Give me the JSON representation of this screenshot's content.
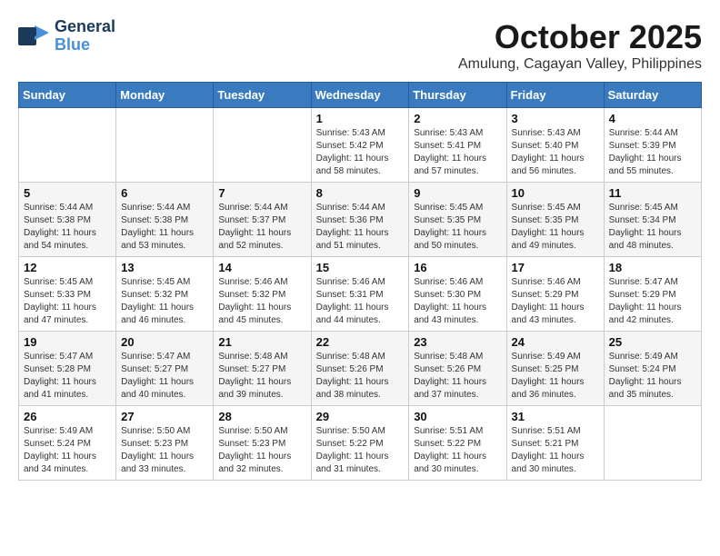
{
  "header": {
    "logo_general": "General",
    "logo_blue": "Blue",
    "month": "October 2025",
    "location": "Amulung, Cagayan Valley, Philippines"
  },
  "days_of_week": [
    "Sunday",
    "Monday",
    "Tuesday",
    "Wednesday",
    "Thursday",
    "Friday",
    "Saturday"
  ],
  "weeks": [
    [
      {
        "day": "",
        "info": ""
      },
      {
        "day": "",
        "info": ""
      },
      {
        "day": "",
        "info": ""
      },
      {
        "day": "1",
        "info": "Sunrise: 5:43 AM\nSunset: 5:42 PM\nDaylight: 11 hours\nand 58 minutes."
      },
      {
        "day": "2",
        "info": "Sunrise: 5:43 AM\nSunset: 5:41 PM\nDaylight: 11 hours\nand 57 minutes."
      },
      {
        "day": "3",
        "info": "Sunrise: 5:43 AM\nSunset: 5:40 PM\nDaylight: 11 hours\nand 56 minutes."
      },
      {
        "day": "4",
        "info": "Sunrise: 5:44 AM\nSunset: 5:39 PM\nDaylight: 11 hours\nand 55 minutes."
      }
    ],
    [
      {
        "day": "5",
        "info": "Sunrise: 5:44 AM\nSunset: 5:38 PM\nDaylight: 11 hours\nand 54 minutes."
      },
      {
        "day": "6",
        "info": "Sunrise: 5:44 AM\nSunset: 5:38 PM\nDaylight: 11 hours\nand 53 minutes."
      },
      {
        "day": "7",
        "info": "Sunrise: 5:44 AM\nSunset: 5:37 PM\nDaylight: 11 hours\nand 52 minutes."
      },
      {
        "day": "8",
        "info": "Sunrise: 5:44 AM\nSunset: 5:36 PM\nDaylight: 11 hours\nand 51 minutes."
      },
      {
        "day": "9",
        "info": "Sunrise: 5:45 AM\nSunset: 5:35 PM\nDaylight: 11 hours\nand 50 minutes."
      },
      {
        "day": "10",
        "info": "Sunrise: 5:45 AM\nSunset: 5:35 PM\nDaylight: 11 hours\nand 49 minutes."
      },
      {
        "day": "11",
        "info": "Sunrise: 5:45 AM\nSunset: 5:34 PM\nDaylight: 11 hours\nand 48 minutes."
      }
    ],
    [
      {
        "day": "12",
        "info": "Sunrise: 5:45 AM\nSunset: 5:33 PM\nDaylight: 11 hours\nand 47 minutes."
      },
      {
        "day": "13",
        "info": "Sunrise: 5:45 AM\nSunset: 5:32 PM\nDaylight: 11 hours\nand 46 minutes."
      },
      {
        "day": "14",
        "info": "Sunrise: 5:46 AM\nSunset: 5:32 PM\nDaylight: 11 hours\nand 45 minutes."
      },
      {
        "day": "15",
        "info": "Sunrise: 5:46 AM\nSunset: 5:31 PM\nDaylight: 11 hours\nand 44 minutes."
      },
      {
        "day": "16",
        "info": "Sunrise: 5:46 AM\nSunset: 5:30 PM\nDaylight: 11 hours\nand 43 minutes."
      },
      {
        "day": "17",
        "info": "Sunrise: 5:46 AM\nSunset: 5:29 PM\nDaylight: 11 hours\nand 43 minutes."
      },
      {
        "day": "18",
        "info": "Sunrise: 5:47 AM\nSunset: 5:29 PM\nDaylight: 11 hours\nand 42 minutes."
      }
    ],
    [
      {
        "day": "19",
        "info": "Sunrise: 5:47 AM\nSunset: 5:28 PM\nDaylight: 11 hours\nand 41 minutes."
      },
      {
        "day": "20",
        "info": "Sunrise: 5:47 AM\nSunset: 5:27 PM\nDaylight: 11 hours\nand 40 minutes."
      },
      {
        "day": "21",
        "info": "Sunrise: 5:48 AM\nSunset: 5:27 PM\nDaylight: 11 hours\nand 39 minutes."
      },
      {
        "day": "22",
        "info": "Sunrise: 5:48 AM\nSunset: 5:26 PM\nDaylight: 11 hours\nand 38 minutes."
      },
      {
        "day": "23",
        "info": "Sunrise: 5:48 AM\nSunset: 5:26 PM\nDaylight: 11 hours\nand 37 minutes."
      },
      {
        "day": "24",
        "info": "Sunrise: 5:49 AM\nSunset: 5:25 PM\nDaylight: 11 hours\nand 36 minutes."
      },
      {
        "day": "25",
        "info": "Sunrise: 5:49 AM\nSunset: 5:24 PM\nDaylight: 11 hours\nand 35 minutes."
      }
    ],
    [
      {
        "day": "26",
        "info": "Sunrise: 5:49 AM\nSunset: 5:24 PM\nDaylight: 11 hours\nand 34 minutes."
      },
      {
        "day": "27",
        "info": "Sunrise: 5:50 AM\nSunset: 5:23 PM\nDaylight: 11 hours\nand 33 minutes."
      },
      {
        "day": "28",
        "info": "Sunrise: 5:50 AM\nSunset: 5:23 PM\nDaylight: 11 hours\nand 32 minutes."
      },
      {
        "day": "29",
        "info": "Sunrise: 5:50 AM\nSunset: 5:22 PM\nDaylight: 11 hours\nand 31 minutes."
      },
      {
        "day": "30",
        "info": "Sunrise: 5:51 AM\nSunset: 5:22 PM\nDaylight: 11 hours\nand 30 minutes."
      },
      {
        "day": "31",
        "info": "Sunrise: 5:51 AM\nSunset: 5:21 PM\nDaylight: 11 hours\nand 30 minutes."
      },
      {
        "day": "",
        "info": ""
      }
    ]
  ]
}
